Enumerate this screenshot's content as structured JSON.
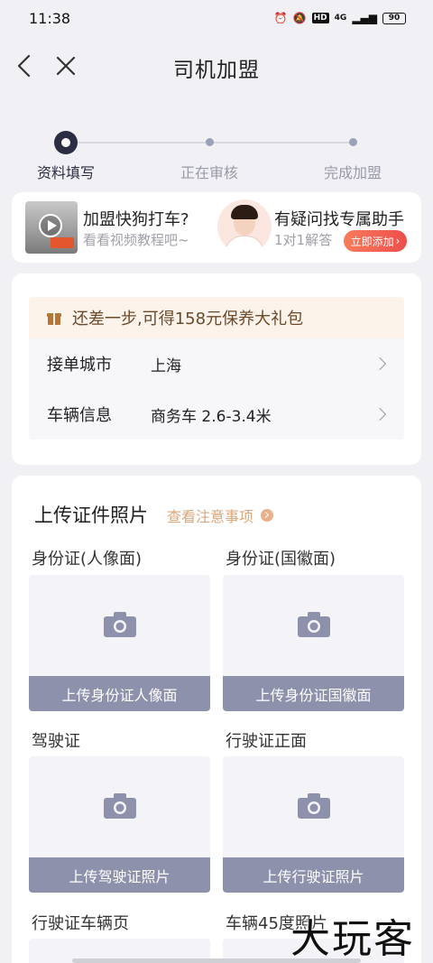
{
  "status": {
    "time": "11:38",
    "hd": "HD",
    "network": "4G",
    "battery": "90"
  },
  "nav": {
    "title": "司机加盟"
  },
  "steps": [
    {
      "label": "资料填写",
      "active": true
    },
    {
      "label": "正在审核",
      "active": false
    },
    {
      "label": "完成加盟",
      "active": false
    }
  ],
  "promo": {
    "video_title": "加盟快狗打车?",
    "video_sub": "看看视频教程吧~",
    "help_title": "有疑问找专属助手",
    "help_sub": "1对1解答",
    "add_button": "立即添加"
  },
  "gift": {
    "text": "还差一步,可得158元保养大礼包"
  },
  "info": {
    "city_label": "接单城市",
    "city_value": "上海",
    "vehicle_label": "车辆信息",
    "vehicle_value": "商务车 2.6-3.4米"
  },
  "upload": {
    "title": "上传证件照片",
    "notice_link": "查看注意事项",
    "slots": [
      {
        "label": "身份证(人像面)",
        "button": "上传身份证人像面"
      },
      {
        "label": "身份证(国徽面)",
        "button": "上传身份证国徽面"
      },
      {
        "label": "驾驶证",
        "button": "上传驾驶证照片"
      },
      {
        "label": "行驶证正面",
        "button": "上传行驶证照片"
      },
      {
        "label": "行驶证车辆页",
        "button": ""
      },
      {
        "label": "车辆45度照片",
        "button": ""
      }
    ]
  },
  "watermark": "大玩客"
}
